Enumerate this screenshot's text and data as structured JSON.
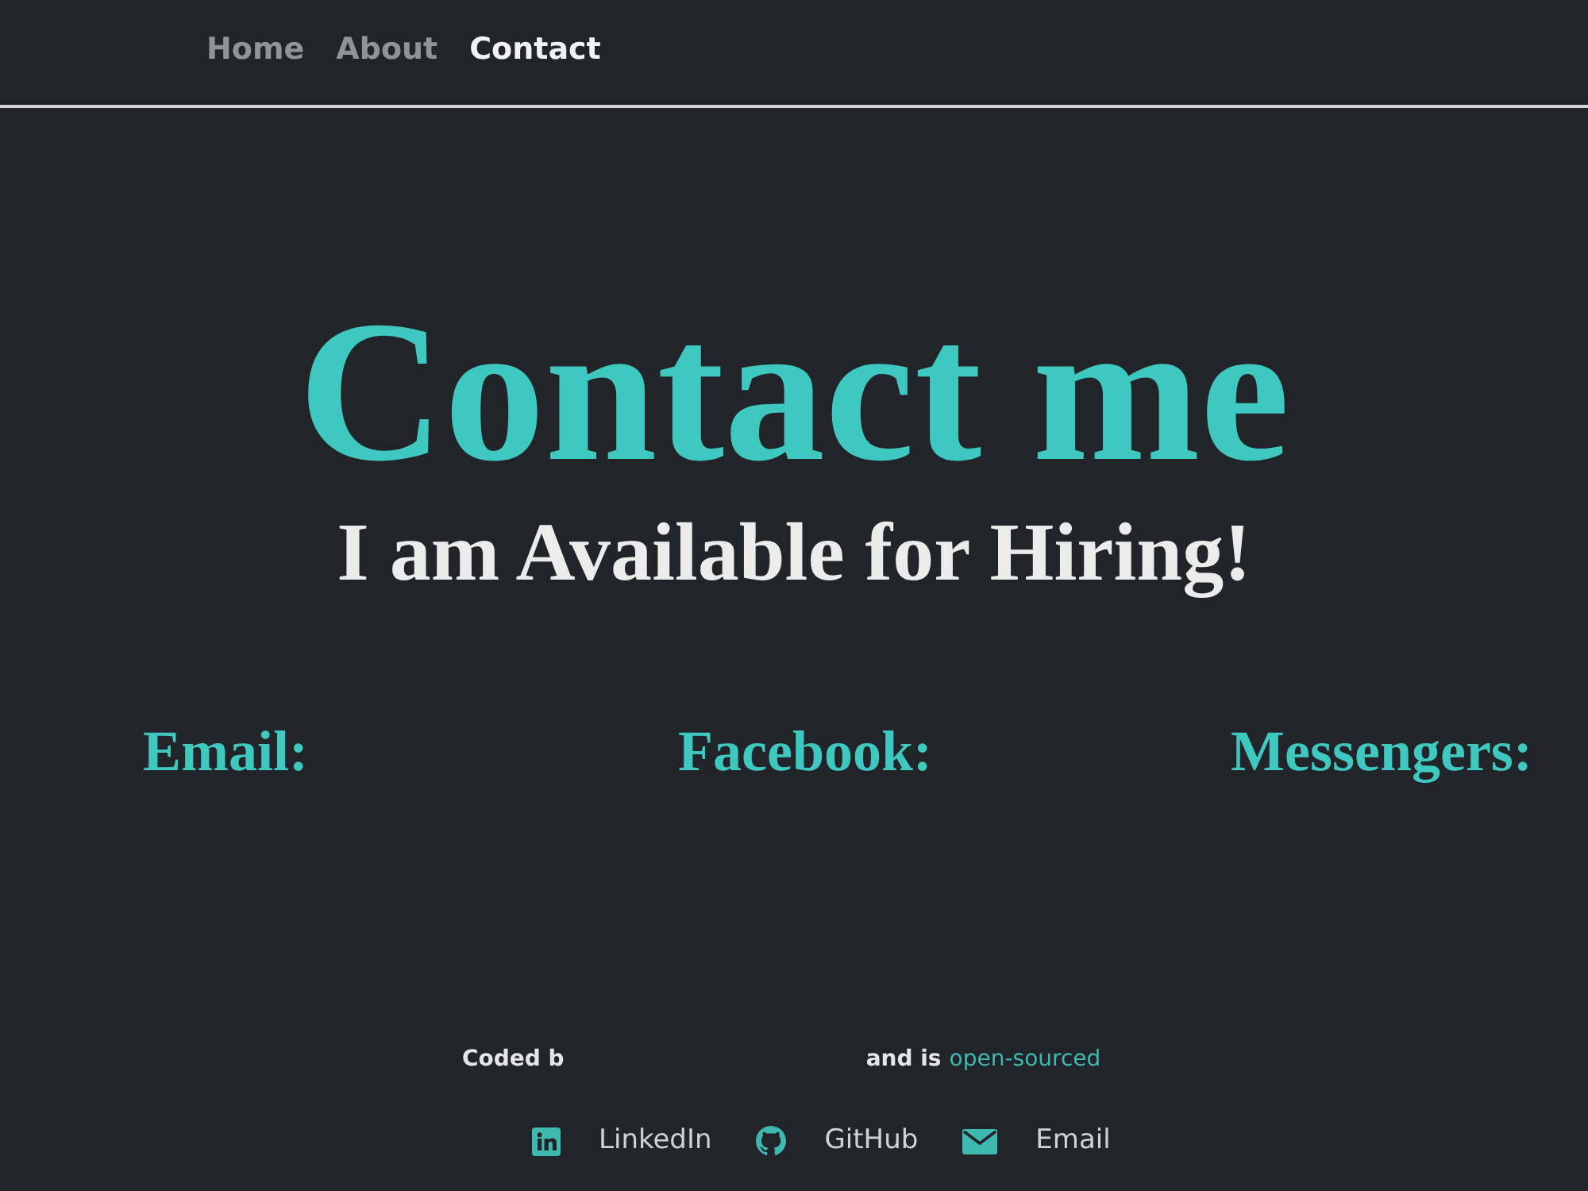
{
  "nav": {
    "items": [
      {
        "label": "Home",
        "selected": false
      },
      {
        "label": "About",
        "selected": false
      },
      {
        "label": "Contact",
        "selected": true
      }
    ]
  },
  "hero": {
    "title": "Contact me",
    "subtitle": "I am Available for Hiring!"
  },
  "contacts": [
    "Email:",
    "Facebook:",
    "Messengers:"
  ],
  "footer": {
    "credit_start": "Coded b",
    "credit_end": "and is",
    "credit_link": "open-sourced",
    "socials": [
      {
        "kind": "linkedin",
        "label": "LinkedIn"
      },
      {
        "kind": "github",
        "label": "GitHub"
      },
      {
        "kind": "email",
        "label": "Email"
      }
    ]
  }
}
